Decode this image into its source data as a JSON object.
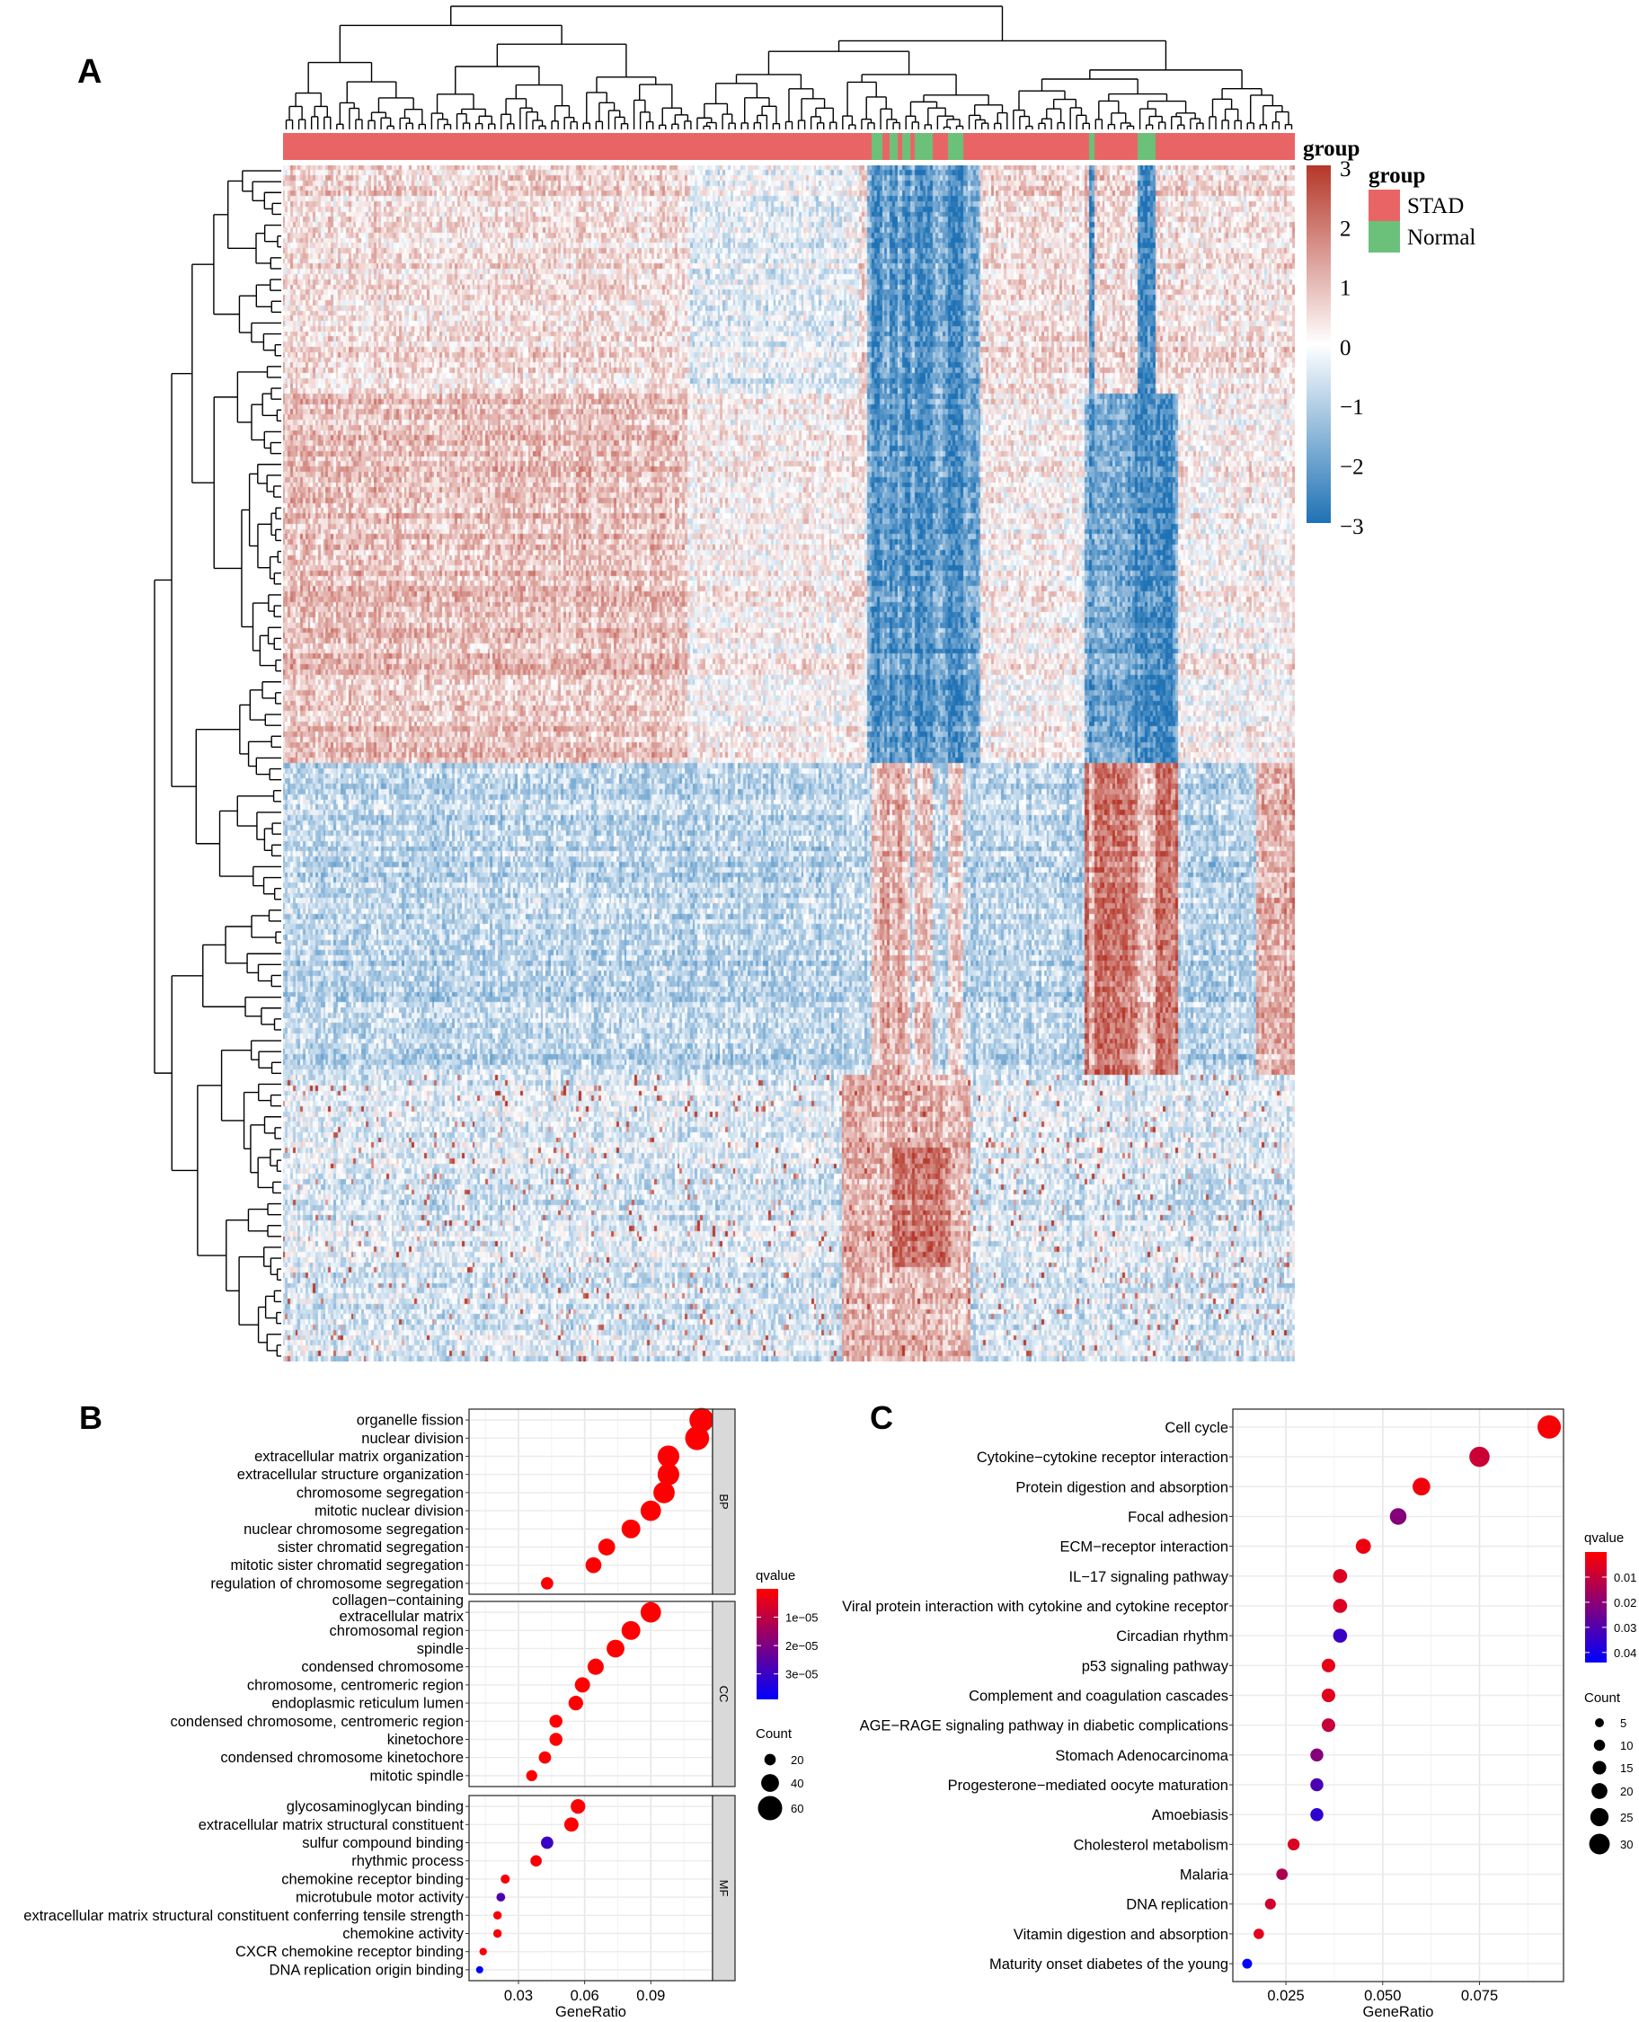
{
  "panels": {
    "a": "A",
    "b": "B",
    "c": "C"
  },
  "chart_data": [
    {
      "type": "heatmap",
      "panel": "A",
      "color_scale": {
        "min": -3,
        "max": 3,
        "ticks": [
          "3",
          "2",
          "1",
          "0",
          "−1",
          "−2",
          "−3"
        ],
        "colors": {
          "low": "#1F72B5",
          "mid": "#FFFFFF",
          "high": "#B5372A"
        }
      },
      "color_legend_title": "group",
      "annotation": {
        "title": "group",
        "levels": [
          {
            "name": "STAD",
            "color": "#E96565"
          },
          {
            "name": "Normal",
            "color": "#6CC17A"
          }
        ],
        "normal_sample_ranges": [
          [
            233,
            236
          ],
          [
            240,
            242
          ],
          [
            245,
            247
          ],
          [
            250,
            256
          ],
          [
            263,
            268
          ],
          [
            319,
            320
          ],
          [
            338,
            344
          ]
        ],
        "sample_count": 400
      },
      "row_dendrogram": true,
      "column_dendrogram": true
    },
    {
      "type": "scatter",
      "panel": "B",
      "xlabel": "GeneRatio",
      "xlim": [
        0.0076,
        0.118
      ],
      "xticks": [
        "0.03",
        "0.06",
        "0.09"
      ],
      "xtick_values": [
        0.03,
        0.06,
        0.09
      ],
      "facets": [
        {
          "name": "BP",
          "terms": [
            {
              "label": "organelle fission",
              "ratio": 0.113,
              "count": 60,
              "q": 1e-07
            },
            {
              "label": "nuclear division",
              "ratio": 0.111,
              "count": 59,
              "q": 1e-07
            },
            {
              "label": "extracellular matrix organization",
              "ratio": 0.098,
              "count": 52,
              "q": 1e-07
            },
            {
              "label": "extracellular structure organization",
              "ratio": 0.098,
              "count": 52,
              "q": 1e-07
            },
            {
              "label": "chromosome segregation",
              "ratio": 0.096,
              "count": 51,
              "q": 1e-07
            },
            {
              "label": "mitotic nuclear division",
              "ratio": 0.09,
              "count": 48,
              "q": 1e-07
            },
            {
              "label": "nuclear chromosome segregation",
              "ratio": 0.081,
              "count": 43,
              "q": 1e-07
            },
            {
              "label": "sister chromatid segregation",
              "ratio": 0.07,
              "count": 37,
              "q": 1e-07
            },
            {
              "label": "mitotic sister chromatid segregation",
              "ratio": 0.064,
              "count": 34,
              "q": 1e-07
            },
            {
              "label": "regulation of chromosome segregation",
              "ratio": 0.043,
              "count": 23,
              "q": 1e-07
            }
          ]
        },
        {
          "name": "CC",
          "terms": [
            {
              "label": "collagen−containing extracellular matrix",
              "ratio": 0.09,
              "count": 48,
              "q": 1e-07
            },
            {
              "label": "chromosomal region",
              "ratio": 0.081,
              "count": 43,
              "q": 1e-07
            },
            {
              "label": "spindle",
              "ratio": 0.074,
              "count": 40,
              "q": 1e-07
            },
            {
              "label": "condensed chromosome",
              "ratio": 0.065,
              "count": 35,
              "q": 1e-07
            },
            {
              "label": "chromosome, centromeric region",
              "ratio": 0.059,
              "count": 32,
              "q": 1e-07
            },
            {
              "label": "endoplasmic reticulum lumen",
              "ratio": 0.056,
              "count": 30,
              "q": 1e-07
            },
            {
              "label": "condensed chromosome, centromeric region",
              "ratio": 0.047,
              "count": 25,
              "q": 1e-07
            },
            {
              "label": "kinetochore",
              "ratio": 0.047,
              "count": 25,
              "q": 1e-07
            },
            {
              "label": "condensed chromosome kinetochore",
              "ratio": 0.042,
              "count": 23,
              "q": 1e-07
            },
            {
              "label": "mitotic spindle",
              "ratio": 0.036,
              "count": 19,
              "q": 1e-07
            }
          ]
        },
        {
          "name": "MF",
          "terms": [
            {
              "label": "glycosaminoglycan binding",
              "ratio": 0.057,
              "count": 30,
              "q": 1e-07
            },
            {
              "label": "extracellular matrix structural constituent",
              "ratio": 0.054,
              "count": 29,
              "q": 1e-07
            },
            {
              "label": "sulfur compound binding",
              "ratio": 0.043,
              "count": 23,
              "q": 3e-05
            },
            {
              "label": "rhythmic process",
              "ratio": 0.038,
              "count": 20,
              "q": 1e-06
            },
            {
              "label": "chemokine receptor binding",
              "ratio": 0.024,
              "count": 13,
              "q": 1e-06
            },
            {
              "label": "microtubule motor activity",
              "ratio": 0.022,
              "count": 12,
              "q": 2.7e-05
            },
            {
              "label": "extracellular matrix structural constituent conferring tensile strength",
              "ratio": 0.0205,
              "count": 11,
              "q": 1e-06
            },
            {
              "label": "chemokine activity",
              "ratio": 0.0205,
              "count": 11,
              "q": 1e-06
            },
            {
              "label": "CXCR chemokine receptor binding",
              "ratio": 0.014,
              "count": 8,
              "q": 1e-06
            },
            {
              "label": "DNA replication origin binding",
              "ratio": 0.0124,
              "count": 7,
              "q": 3.9e-05
            }
          ]
        }
      ],
      "color_legend": {
        "title": "qvalue",
        "range": [
          0,
          3.9e-05
        ],
        "ticks": [
          "1e−05",
          "2e−05",
          "3e−05"
        ],
        "tick_values": [
          1e-05,
          2e-05,
          3e-05
        ],
        "low_color": "#FF0000",
        "high_color": "#0000FF"
      },
      "size_legend": {
        "title": "Count",
        "values": [
          20,
          40,
          60
        ],
        "labels": [
          "20",
          "40",
          "60"
        ]
      }
    },
    {
      "type": "scatter",
      "panel": "C",
      "xlabel": "GeneRatio",
      "xlim": [
        0.0113,
        0.0967
      ],
      "xticks": [
        "0.025",
        "0.050",
        "0.075"
      ],
      "xtick_values": [
        0.025,
        0.05,
        0.075
      ],
      "terms": [
        {
          "label": "Cell cycle",
          "ratio": 0.093,
          "count": 31,
          "q": 0.001
        },
        {
          "label": "Cytokine−cytokine receptor interaction",
          "ratio": 0.075,
          "count": 25,
          "q": 0.009
        },
        {
          "label": "Protein digestion and absorption",
          "ratio": 0.06,
          "count": 20,
          "q": 0.002
        },
        {
          "label": "Focal adhesion",
          "ratio": 0.054,
          "count": 18,
          "q": 0.021
        },
        {
          "label": "ECM−receptor interaction",
          "ratio": 0.045,
          "count": 15,
          "q": 0.003
        },
        {
          "label": "IL−17 signaling pathway",
          "ratio": 0.039,
          "count": 13,
          "q": 0.006
        },
        {
          "label": "Viral protein interaction with cytokine and cytokine receptor",
          "ratio": 0.039,
          "count": 13,
          "q": 0.006
        },
        {
          "label": "Circadian  rhythm",
          "ratio": 0.039,
          "count": 13,
          "q": 0.034
        },
        {
          "label": "p53 signaling pathway",
          "ratio": 0.036,
          "count": 12,
          "q": 0.004
        },
        {
          "label": "Complement and coagulation cascades",
          "ratio": 0.036,
          "count": 12,
          "q": 0.005
        },
        {
          "label": "AGE−RAGE signaling pathway in diabetic complications",
          "ratio": 0.036,
          "count": 12,
          "q": 0.01
        },
        {
          "label": "Stomach Adenocarcinoma",
          "ratio": 0.033,
          "count": 11,
          "q": 0.021
        },
        {
          "label": "Progesterone−mediated oocyte maturation",
          "ratio": 0.033,
          "count": 11,
          "q": 0.031
        },
        {
          "label": "Amoebiasis",
          "ratio": 0.033,
          "count": 11,
          "q": 0.036
        },
        {
          "label": "Cholesterol metabolism",
          "ratio": 0.027,
          "count": 9,
          "q": 0.006
        },
        {
          "label": "Malaria",
          "ratio": 0.024,
          "count": 8,
          "q": 0.014
        },
        {
          "label": "DNA replication",
          "ratio": 0.021,
          "count": 7,
          "q": 0.008
        },
        {
          "label": "Vitamin digestion and absorption",
          "ratio": 0.018,
          "count": 6,
          "q": 0.005
        },
        {
          "label": "Maturity onset diabetes of the young",
          "ratio": 0.015,
          "count": 5,
          "q": 0.044
        }
      ],
      "color_legend": {
        "title": "qvalue",
        "range": [
          0,
          0.044
        ],
        "ticks": [
          "0.01",
          "0.02",
          "0.03",
          "0.04"
        ],
        "tick_values": [
          0.01,
          0.02,
          0.03,
          0.04
        ],
        "low_color": "#FF0000",
        "high_color": "#0000FF"
      },
      "size_legend": {
        "title": "Count",
        "values": [
          5,
          10,
          15,
          20,
          25,
          30
        ],
        "labels": [
          "5",
          "10",
          "15",
          "20",
          "25",
          "30"
        ]
      }
    }
  ]
}
